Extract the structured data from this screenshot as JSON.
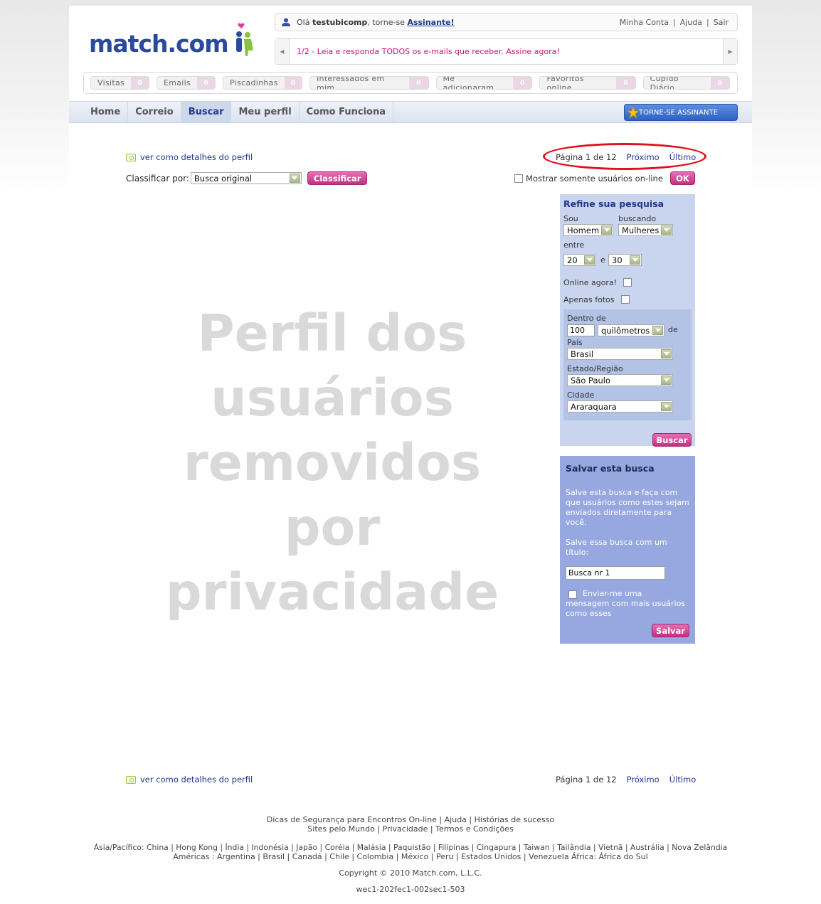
{
  "header": {
    "logo_text": "match.com",
    "user": {
      "greeting_prefix": "Olá ",
      "username": "testubicomp",
      "greeting_mid": ", torne-se ",
      "subscribe_link": "Assinante!"
    },
    "account_links": [
      "Minha Conta",
      "Ajuda",
      "Sair"
    ],
    "ticker_message": "1/2 - Leia e responda TODOS os e-mails que receber. Assine agora!"
  },
  "counters": [
    {
      "label": "Visitas",
      "count": "0"
    },
    {
      "label": "Emails",
      "count": "0"
    },
    {
      "label": "Piscadinhas",
      "count": "0"
    },
    {
      "label": "Interessados em mim",
      "count": "0"
    },
    {
      "label": "Me adicionaram",
      "count": "0"
    },
    {
      "label": "Favoritos online",
      "count": "0"
    },
    {
      "label": "Cupido Diário",
      "count": "0"
    }
  ],
  "nav": {
    "tabs": [
      "Home",
      "Correio",
      "Buscar",
      "Meu perfil",
      "Como Funciona"
    ],
    "active_tab": "Buscar",
    "cta_label": "TORNE-SE ASSINANTE"
  },
  "results": {
    "view_link": "ver como detalhes do perfil",
    "pager": {
      "page_text": "Página 1 de 12",
      "next": "Próximo",
      "last": "Último"
    },
    "sort_label": "Classificar por:",
    "sort_value": "Busca original",
    "sort_button": "Classificar",
    "online_only_label": "Mostrar somente usuários on-line",
    "ok_button": "OK",
    "privacy_placeholder": [
      "Perfil dos",
      "usuários",
      "removidos por",
      "privacidade"
    ]
  },
  "refine": {
    "title": "Refine sua pesquisa",
    "sou_label": "Sou",
    "sou_value": "Homem",
    "buscando_label": "buscando",
    "buscando_value": "Mulheres",
    "entre_label": "entre",
    "age_min": "20",
    "age_and": "e",
    "age_max": "30",
    "online_label": "Online agora!",
    "photos_label": "Apenas fotos",
    "within_label": "Dentro de",
    "distance_value": "100",
    "distance_unit": "quilômetros",
    "de_label": "de",
    "country_label": "País",
    "country_value": "Brasil",
    "state_label": "Estado/Região",
    "state_value": "São Paulo",
    "city_label": "Cidade",
    "city_value": "Araraquara",
    "search_button": "Buscar"
  },
  "save_search": {
    "title": "Salvar esta busca",
    "description": "Salve esta busca e faça com que usuários como estes sejam enviados diretamente para você.",
    "title_prompt": "Salve essa busca com um título:",
    "title_value": "Busca nr 1",
    "email_opt_first": "Enviar-me uma",
    "email_opt_rest": "mensagem com mais usuários como esses",
    "save_button": "Salvar"
  },
  "footer": {
    "line1": [
      "Dicas de Segurança para Encontros On-line",
      "Ajuda",
      "Histórias de sucesso"
    ],
    "line2": [
      "Sites pelo Mundo",
      "Privacidade",
      "Termos e Condições"
    ],
    "asia": "Ásia/Pacífico: China | Hong Kong | Índia | Indonésia | Japão | Coréia | Malásia | Paquistão | Filipinas | Cingapura | Taiwan | Tailândia | Vietnã | Austrália | Nova Zelândia",
    "americas": "Américas : Argentina | Brasil | Canadá | Chile | Colombia | México | Peru | Estados Unidos | Venezuela África: África do Sul",
    "copyright": "Copyright © 2010 Match.com, L.L.C.",
    "server_id": "wec1-202fec1-002sec1-503"
  },
  "colors": {
    "brand_blue": "#2a4a9b",
    "brand_pink": "#c2307f",
    "refine_bg": "#c9d5ee",
    "save_bg": "#96a8df",
    "highlight_red": "#e01020"
  }
}
